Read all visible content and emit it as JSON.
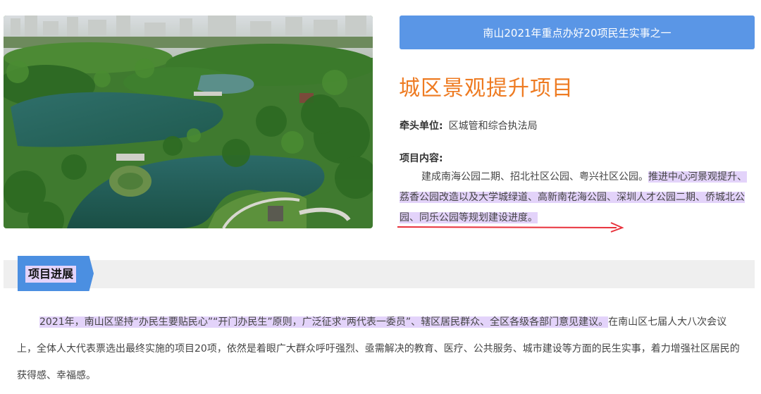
{
  "photo": {
    "alt": "Aerial view of park with lake"
  },
  "banner": {
    "text": "南山2021年重点办好20项民生实事之一"
  },
  "project": {
    "title": "城区景观提升项目"
  },
  "lead_unit": {
    "label": "牵头单位:",
    "value": "区城管和综合执法局"
  },
  "content": {
    "label": "项目内容:",
    "text_plain": "建成南海公园二期、招北社区公园、粤兴社区公园。",
    "text_highlight": "推进中心河景观提升、荔香公园改造以及大学城绿道、高新南花海公园、深圳人才公园二期、侨城北公园、同乐公园等规划建设进度。"
  },
  "section": {
    "title": "项目进展"
  },
  "paragraph": {
    "highlight": "2021年，南山区坚持“办民生要贴民心”“开门办民生”原则，广泛征求“两代表一委员”、辖区居民群众、全区各级各部门意见建议。",
    "rest": "在南山区七届人大八次会议上，全体人大代表票选出最终实施的项目20项，依然是着眼广大群众呼吁强烈、亟需解决的教育、医疗、公共服务、城市建设等方面的民生实事，着力增强社区居民的获得感、幸福感。"
  },
  "colors": {
    "banner": "#5a96e6",
    "title": "#ee7b22",
    "highlight": "#e3d3fa",
    "arrow": "#e8323c"
  }
}
